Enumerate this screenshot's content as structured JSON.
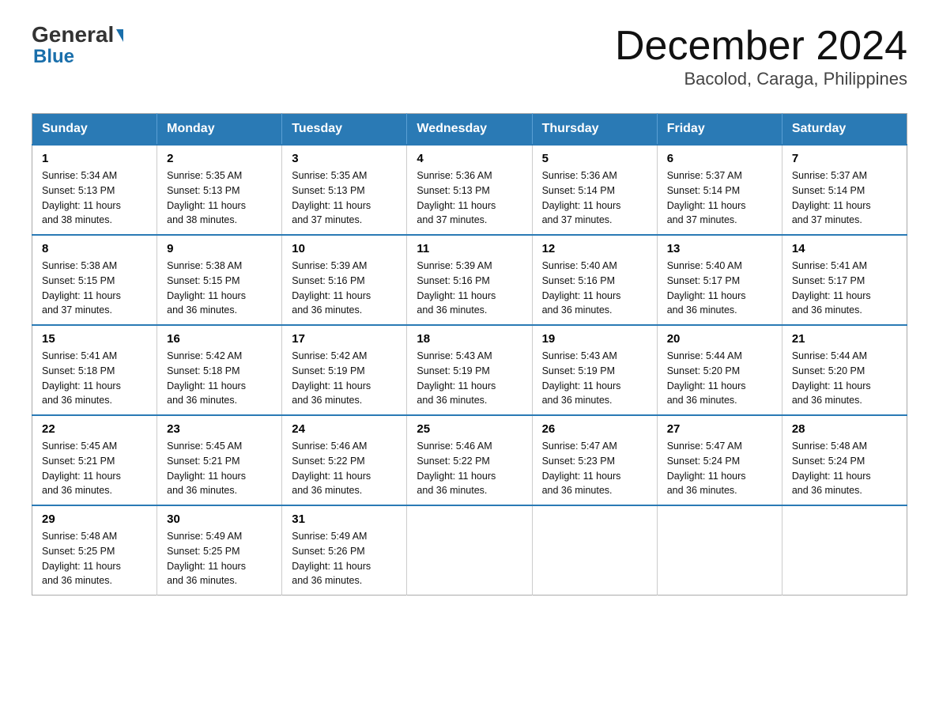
{
  "header": {
    "logo_general": "General",
    "logo_blue": "Blue",
    "title": "December 2024",
    "subtitle": "Bacolod, Caraga, Philippines"
  },
  "days_of_week": [
    "Sunday",
    "Monday",
    "Tuesday",
    "Wednesday",
    "Thursday",
    "Friday",
    "Saturday"
  ],
  "weeks": [
    [
      {
        "day": "1",
        "sunrise": "5:34 AM",
        "sunset": "5:13 PM",
        "daylight": "11 hours and 38 minutes."
      },
      {
        "day": "2",
        "sunrise": "5:35 AM",
        "sunset": "5:13 PM",
        "daylight": "11 hours and 38 minutes."
      },
      {
        "day": "3",
        "sunrise": "5:35 AM",
        "sunset": "5:13 PM",
        "daylight": "11 hours and 37 minutes."
      },
      {
        "day": "4",
        "sunrise": "5:36 AM",
        "sunset": "5:13 PM",
        "daylight": "11 hours and 37 minutes."
      },
      {
        "day": "5",
        "sunrise": "5:36 AM",
        "sunset": "5:14 PM",
        "daylight": "11 hours and 37 minutes."
      },
      {
        "day": "6",
        "sunrise": "5:37 AM",
        "sunset": "5:14 PM",
        "daylight": "11 hours and 37 minutes."
      },
      {
        "day": "7",
        "sunrise": "5:37 AM",
        "sunset": "5:14 PM",
        "daylight": "11 hours and 37 minutes."
      }
    ],
    [
      {
        "day": "8",
        "sunrise": "5:38 AM",
        "sunset": "5:15 PM",
        "daylight": "11 hours and 37 minutes."
      },
      {
        "day": "9",
        "sunrise": "5:38 AM",
        "sunset": "5:15 PM",
        "daylight": "11 hours and 36 minutes."
      },
      {
        "day": "10",
        "sunrise": "5:39 AM",
        "sunset": "5:16 PM",
        "daylight": "11 hours and 36 minutes."
      },
      {
        "day": "11",
        "sunrise": "5:39 AM",
        "sunset": "5:16 PM",
        "daylight": "11 hours and 36 minutes."
      },
      {
        "day": "12",
        "sunrise": "5:40 AM",
        "sunset": "5:16 PM",
        "daylight": "11 hours and 36 minutes."
      },
      {
        "day": "13",
        "sunrise": "5:40 AM",
        "sunset": "5:17 PM",
        "daylight": "11 hours and 36 minutes."
      },
      {
        "day": "14",
        "sunrise": "5:41 AM",
        "sunset": "5:17 PM",
        "daylight": "11 hours and 36 minutes."
      }
    ],
    [
      {
        "day": "15",
        "sunrise": "5:41 AM",
        "sunset": "5:18 PM",
        "daylight": "11 hours and 36 minutes."
      },
      {
        "day": "16",
        "sunrise": "5:42 AM",
        "sunset": "5:18 PM",
        "daylight": "11 hours and 36 minutes."
      },
      {
        "day": "17",
        "sunrise": "5:42 AM",
        "sunset": "5:19 PM",
        "daylight": "11 hours and 36 minutes."
      },
      {
        "day": "18",
        "sunrise": "5:43 AM",
        "sunset": "5:19 PM",
        "daylight": "11 hours and 36 minutes."
      },
      {
        "day": "19",
        "sunrise": "5:43 AM",
        "sunset": "5:19 PM",
        "daylight": "11 hours and 36 minutes."
      },
      {
        "day": "20",
        "sunrise": "5:44 AM",
        "sunset": "5:20 PM",
        "daylight": "11 hours and 36 minutes."
      },
      {
        "day": "21",
        "sunrise": "5:44 AM",
        "sunset": "5:20 PM",
        "daylight": "11 hours and 36 minutes."
      }
    ],
    [
      {
        "day": "22",
        "sunrise": "5:45 AM",
        "sunset": "5:21 PM",
        "daylight": "11 hours and 36 minutes."
      },
      {
        "day": "23",
        "sunrise": "5:45 AM",
        "sunset": "5:21 PM",
        "daylight": "11 hours and 36 minutes."
      },
      {
        "day": "24",
        "sunrise": "5:46 AM",
        "sunset": "5:22 PM",
        "daylight": "11 hours and 36 minutes."
      },
      {
        "day": "25",
        "sunrise": "5:46 AM",
        "sunset": "5:22 PM",
        "daylight": "11 hours and 36 minutes."
      },
      {
        "day": "26",
        "sunrise": "5:47 AM",
        "sunset": "5:23 PM",
        "daylight": "11 hours and 36 minutes."
      },
      {
        "day": "27",
        "sunrise": "5:47 AM",
        "sunset": "5:24 PM",
        "daylight": "11 hours and 36 minutes."
      },
      {
        "day": "28",
        "sunrise": "5:48 AM",
        "sunset": "5:24 PM",
        "daylight": "11 hours and 36 minutes."
      }
    ],
    [
      {
        "day": "29",
        "sunrise": "5:48 AM",
        "sunset": "5:25 PM",
        "daylight": "11 hours and 36 minutes."
      },
      {
        "day": "30",
        "sunrise": "5:49 AM",
        "sunset": "5:25 PM",
        "daylight": "11 hours and 36 minutes."
      },
      {
        "day": "31",
        "sunrise": "5:49 AM",
        "sunset": "5:26 PM",
        "daylight": "11 hours and 36 minutes."
      },
      null,
      null,
      null,
      null
    ]
  ],
  "labels": {
    "sunrise": "Sunrise:",
    "sunset": "Sunset:",
    "daylight": "Daylight:"
  }
}
